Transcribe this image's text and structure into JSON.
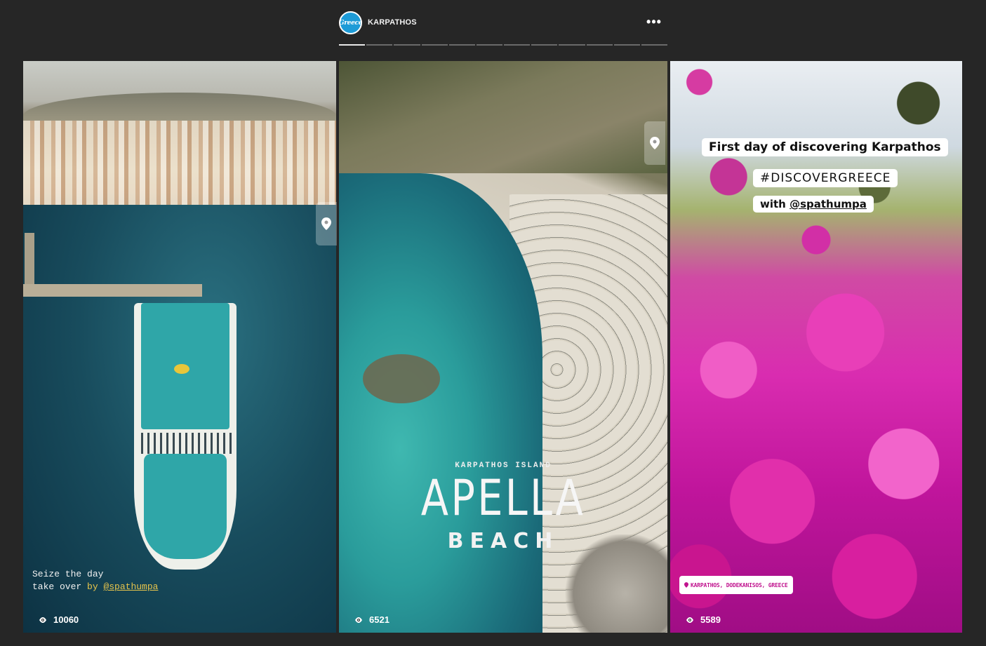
{
  "header": {
    "avatar_text": "Greece",
    "account_name": "KARPATHOS",
    "more_label": "•••"
  },
  "progress": {
    "segments": 12,
    "completed": 1
  },
  "stories": [
    {
      "caption_line1": "Seize the day",
      "caption_line2_prefix": "take over",
      "caption_line2_by": "by",
      "caption_mention": "@spathumpa",
      "views": "10060"
    },
    {
      "subtitle": "KARPATHOS ISLAND",
      "title": "APELLA",
      "subtitle2": "BEACH",
      "views": "6521"
    },
    {
      "sticker_title": "First day of discovering Karpathos",
      "sticker_hashtag": "#DISCOVERGREECE",
      "sticker_with": "with",
      "sticker_mention": "@spathumpa",
      "location": "KARPATHOS, DODEKANISOS, GREECE",
      "views": "5589"
    }
  ],
  "colors": {
    "background": "#262626",
    "caption_accent": "#e6c44c",
    "location_text": "#c0138e",
    "avatar_bg": "#1d9bd7"
  },
  "icons": {
    "pin": "location-pin-icon",
    "eye": "eye-icon",
    "more": "more-dots-icon"
  }
}
